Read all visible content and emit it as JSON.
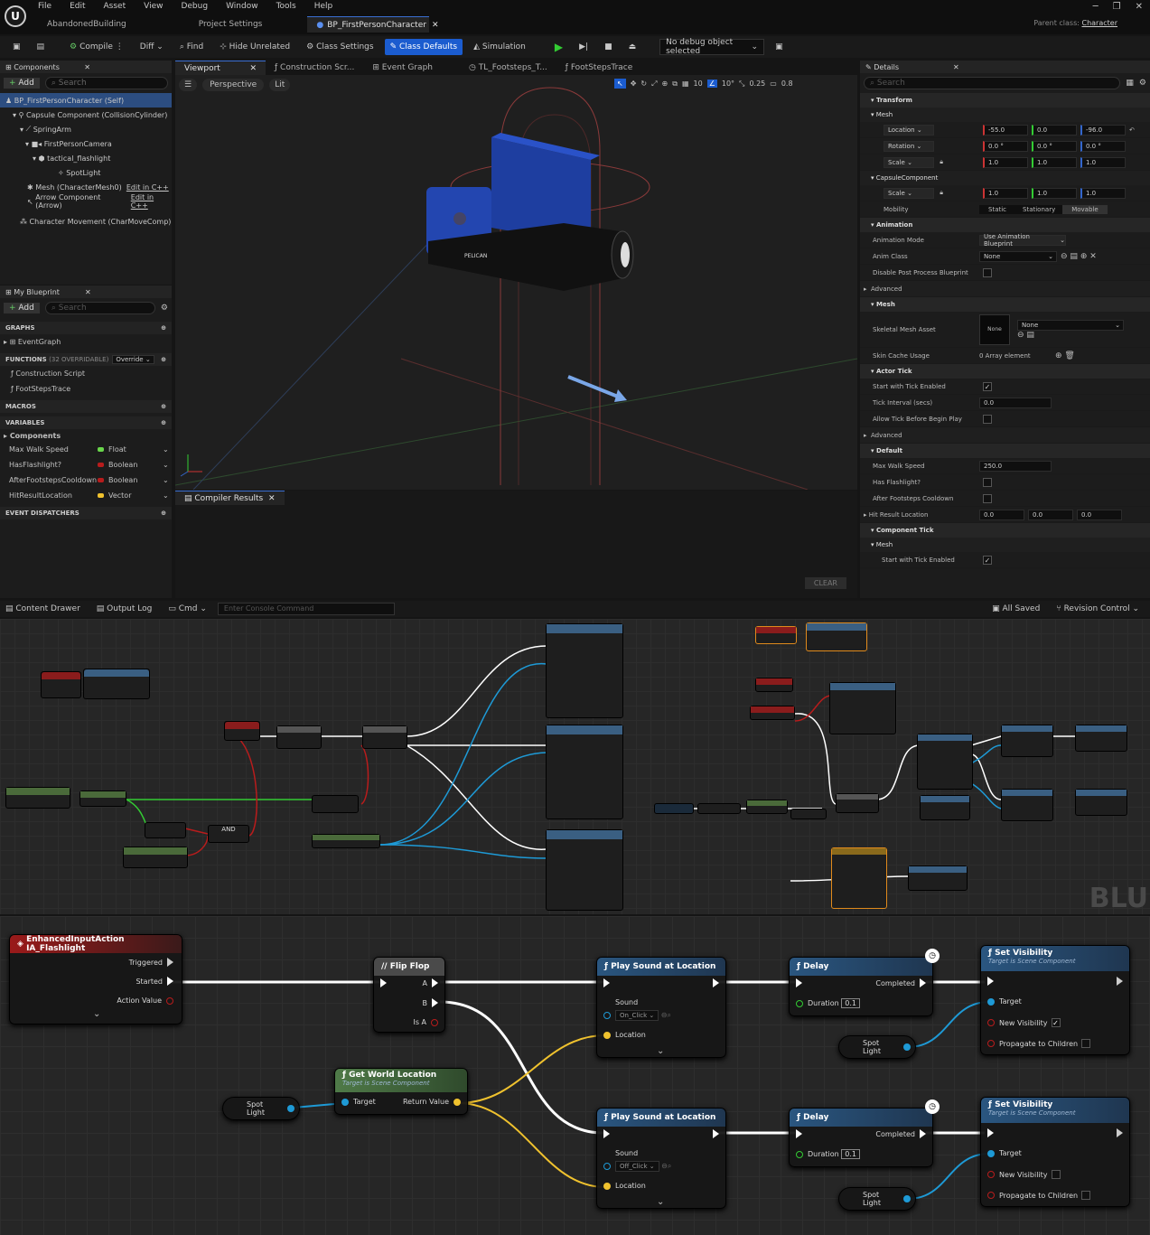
{
  "menu": {
    "items": [
      "File",
      "Edit",
      "Asset",
      "View",
      "Debug",
      "Window",
      "Tools",
      "Help"
    ],
    "project": "AbandonedBuilding",
    "tab_settings": "Project Settings",
    "tab_bp": "BP_FirstPersonCharacter",
    "parent_label": "Parent class:",
    "parent_value": "Character"
  },
  "toolbar": {
    "compile": "Compile",
    "diff": "Diff",
    "find": "Find",
    "hide": "Hide Unrelated",
    "class_settings": "Class Settings",
    "class_defaults": "Class Defaults",
    "simulation": "Simulation",
    "debug": "No debug object selected"
  },
  "components": {
    "title": "Components",
    "add": "Add",
    "search": "Search",
    "items": [
      "BP_FirstPersonCharacter (Self)",
      "Capsule Component (CollisionCylinder)",
      "SpringArm",
      "FirstPersonCamera",
      "tactical_flashlight",
      "SpotLight",
      "Mesh (CharacterMesh0)",
      "Arrow Component (Arrow)",
      "Character Movement (CharMoveComp)"
    ],
    "edit": "Edit in C++"
  },
  "myblueprint": {
    "title": "My Blueprint",
    "add": "Add",
    "search": "Search",
    "graphs": "GRAPHS",
    "event_graph": "EventGraph",
    "functions": "FUNCTIONS",
    "overridable": "(32 OVERRIDABLE)",
    "override": "Override",
    "fn1": "Construction Script",
    "fn2": "FootStepsTrace",
    "macros": "MACROS",
    "variables": "VARIABLES",
    "comp": "Components",
    "vars": [
      {
        "name": "Max Walk Speed",
        "type": "Float",
        "color": "#69d64b"
      },
      {
        "name": "HasFlashlight?",
        "type": "Boolean",
        "color": "#b81c1c"
      },
      {
        "name": "AfterFootstepsCooldown",
        "type": "Boolean",
        "color": "#b81c1c"
      },
      {
        "name": "HitResultLocation",
        "type": "Vector",
        "color": "#f0c22e"
      }
    ],
    "dispatchers": "EVENT DISPATCHERS"
  },
  "viewport": {
    "tabs": [
      "Viewport",
      "Construction Scr...",
      "Event Graph",
      "TL_Footsteps_T...",
      "FootStepsTrace"
    ],
    "perspective": "Perspective",
    "lit": "Lit",
    "grid": "10",
    "angle": "10°",
    "scale": "0.25",
    "cam": "0.8",
    "brand": "PELICAN"
  },
  "compiler": {
    "title": "Compiler Results",
    "clear": "CLEAR"
  },
  "details": {
    "title": "Details",
    "search": "Search",
    "transform": "Transform",
    "mesh": "Mesh",
    "location": "Location",
    "loc": [
      "-55.0",
      "0.0",
      "-96.0"
    ],
    "rotation": "Rotation",
    "rot": [
      "0.0 °",
      "0.0 °",
      "0.0 °"
    ],
    "scale": "Scale",
    "scl": [
      "1.0",
      "1.0",
      "1.0"
    ],
    "capsule": "CapsuleComponent",
    "mobility": "Mobility",
    "mob": [
      "Static",
      "Stationary",
      "Movable"
    ],
    "animation": "Animation",
    "anim_mode": "Animation Mode",
    "anim_mode_v": "Use Animation Blueprint",
    "anim_class": "Anim Class",
    "none": "None",
    "disable_pp": "Disable Post Process Blueprint",
    "advanced": "Advanced",
    "skm": "Skeletal Mesh Asset",
    "skin": "Skin Cache Usage",
    "skin_v": "0 Array element",
    "actor_tick": "Actor Tick",
    "start_tick": "Start with Tick Enabled",
    "interval": "Tick Interval (secs)",
    "interval_v": "0.0",
    "allow_tick": "Allow Tick Before Begin Play",
    "default": "Default",
    "mws": "Max Walk Speed",
    "mws_v": "250.0",
    "hasfl": "Has Flashlight?",
    "afc": "After Footsteps Cooldown",
    "hrl": "Hit Result Location",
    "hrl_v": [
      "0.0",
      "0.0",
      "0.0"
    ],
    "comp_tick": "Component Tick",
    "mesh2": "Mesh",
    "start_tick2": "Start with Tick Enabled"
  },
  "bottom": {
    "drawer": "Content Drawer",
    "output": "Output Log",
    "cmd": "Cmd",
    "console": "Enter Console Command",
    "saved": "All Saved",
    "revision": "Revision Control"
  },
  "graph_zoomed": {
    "watermark": "BLU"
  },
  "nodes": {
    "enhanced": {
      "title": "EnhancedInputAction IA_Flashlight",
      "triggered": "Triggered",
      "started": "Started",
      "action": "Action Value"
    },
    "flipflop": {
      "title": "Flip Flop",
      "a": "A",
      "b": "B",
      "isa": "Is A"
    },
    "play1": {
      "title": "Play Sound at Location",
      "sound": "Sound",
      "sound_v": "On_Click",
      "location": "Location"
    },
    "play2": {
      "title": "Play Sound at Location",
      "sound": "Sound",
      "sound_v": "Off_Click",
      "location": "Location"
    },
    "delay1": {
      "title": "Delay",
      "completed": "Completed",
      "duration": "Duration",
      "duration_v": "0.1"
    },
    "delay2": {
      "title": "Delay",
      "completed": "Completed",
      "duration": "Duration",
      "duration_v": "0.1"
    },
    "setvis1": {
      "title": "Set Visibility",
      "sub": "Target is Scene Component",
      "target": "Target",
      "newvis": "New Visibility",
      "prop": "Propagate to Children"
    },
    "setvis2": {
      "title": "Set Visibility",
      "sub": "Target is Scene Component",
      "target": "Target",
      "newvis": "New Visibility",
      "prop": "Propagate to Children"
    },
    "getworld": {
      "title": "Get World Location",
      "sub": "Target is Scene Component",
      "target": "Target",
      "ret": "Return Value"
    },
    "spot": "Spot Light"
  }
}
